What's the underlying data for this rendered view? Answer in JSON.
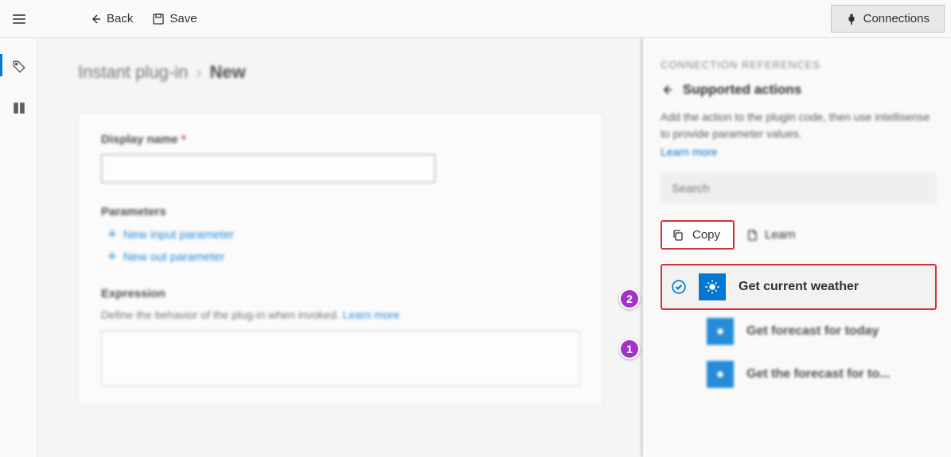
{
  "topbar": {
    "back": "Back",
    "save": "Save",
    "connections": "Connections"
  },
  "breadcrumb": {
    "parent": "Instant plug-in",
    "current": "New"
  },
  "form": {
    "display_name_label": "Display name",
    "parameters_label": "Parameters",
    "new_input": "New input parameter",
    "new_out": "New out parameter",
    "expression_label": "Expression",
    "expression_desc": "Define the behavior of the plug-in when invoked.",
    "expression_learn": "Learn more"
  },
  "right": {
    "header": "CONNECTION REFERENCES",
    "title": "Supported actions",
    "desc": "Add the action to the plugin code, then use intellisense to provide parameter values.",
    "learn": "Learn more",
    "search_placeholder": "Search",
    "copy": "Copy",
    "learn_btn": "Learn",
    "actions": [
      "Get current weather",
      "Get forecast for today",
      "Get the forecast for to..."
    ]
  },
  "callouts": {
    "one": "1",
    "two": "2"
  }
}
